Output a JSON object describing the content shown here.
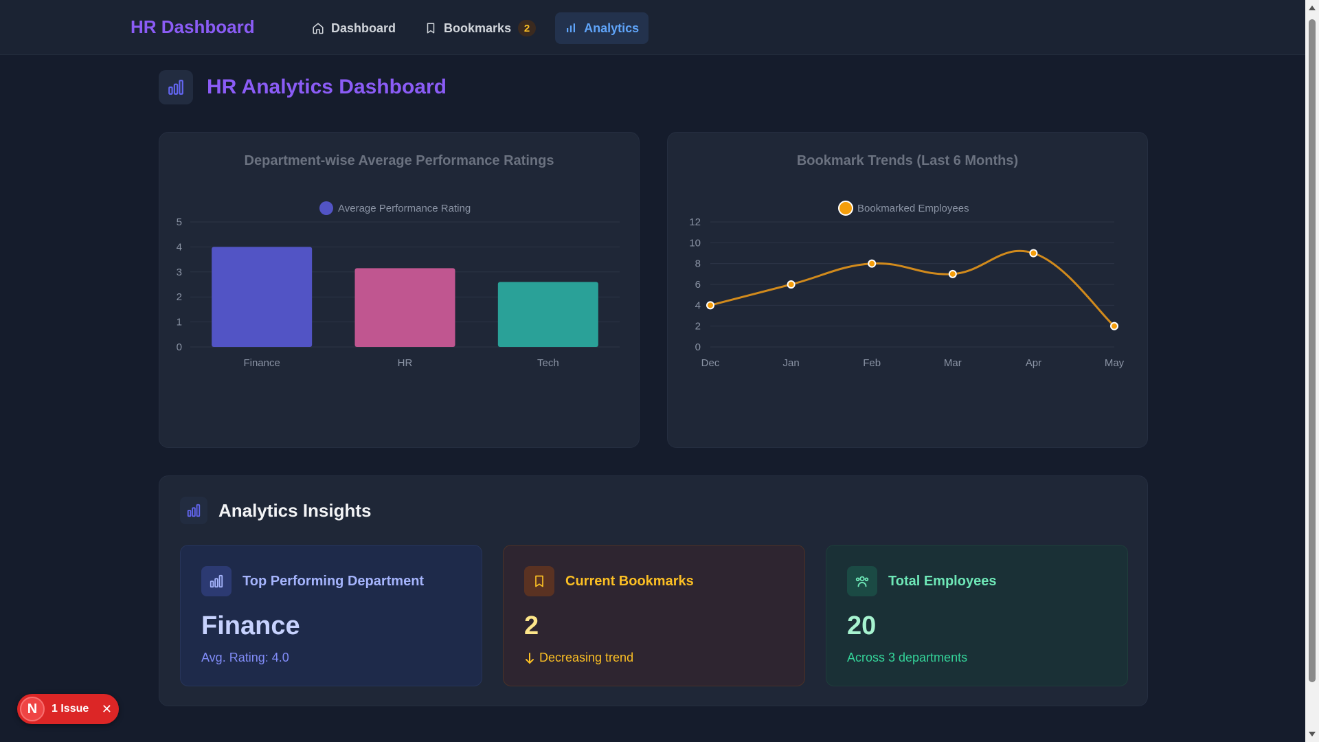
{
  "app": {
    "brand": "HR Dashboard"
  },
  "nav": {
    "items": [
      {
        "label": "Dashboard",
        "icon": "home-icon"
      },
      {
        "label": "Bookmarks",
        "icon": "bookmark-icon",
        "badge": "2"
      },
      {
        "label": "Analytics",
        "icon": "bar-chart-icon",
        "active": true
      }
    ]
  },
  "page": {
    "title": "HR Analytics Dashboard"
  },
  "colors": {
    "brand": "#8b5cf6",
    "active_nav": "#60a5fa",
    "finance_bar": "#5254c5",
    "hr_bar": "#c05690",
    "tech_bar": "#2aa198",
    "line": "#d18a1c",
    "danger": "#dc2626"
  },
  "chart_data": [
    {
      "type": "bar",
      "title": "Department-wise Average Performance Ratings",
      "categories": [
        "Finance",
        "HR",
        "Tech"
      ],
      "series": [
        {
          "name": "Average Performance Rating",
          "values": [
            4.0,
            3.15,
            2.6
          ]
        }
      ],
      "yticks": [
        "0",
        "1",
        "2",
        "3",
        "4",
        "5"
      ],
      "ylim": [
        0,
        5
      ],
      "grid": true,
      "legend": "top"
    },
    {
      "type": "line",
      "title": "Bookmark Trends (Last 6 Months)",
      "categories": [
        "Dec",
        "Jan",
        "Feb",
        "Mar",
        "Apr",
        "May"
      ],
      "series": [
        {
          "name": "Bookmarked Employees",
          "values": [
            4,
            6,
            8,
            7,
            9,
            2
          ]
        }
      ],
      "yticks": [
        "0",
        "2",
        "4",
        "6",
        "8",
        "10",
        "12"
      ],
      "ylim": [
        0,
        12
      ],
      "grid": true,
      "legend": "top"
    }
  ],
  "insights": {
    "title": "Analytics Insights",
    "cards": [
      {
        "label": "Top Performing Department",
        "value": "Finance",
        "sub": "Avg. Rating: 4.0"
      },
      {
        "label": "Current Bookmarks",
        "value": "2",
        "sub": "Decreasing trend"
      },
      {
        "label": "Total Employees",
        "value": "20",
        "sub": "Across 3 departments"
      }
    ]
  },
  "issue_badge": {
    "logo": "N",
    "text": "1 Issue"
  }
}
